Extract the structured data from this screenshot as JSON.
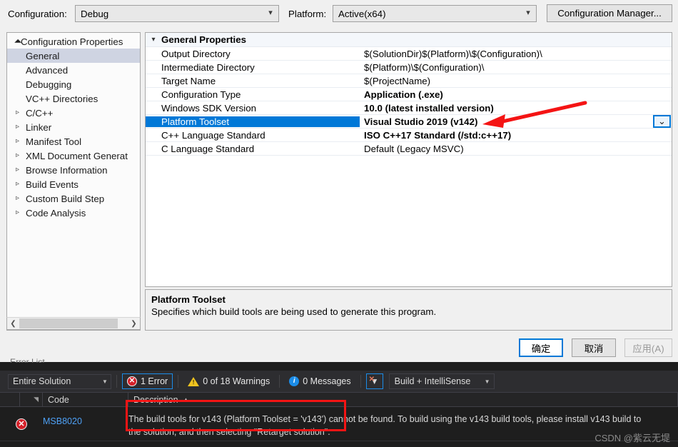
{
  "dialog": {
    "config_bar": {
      "configuration_label": "Configuration:",
      "configuration_value": "Debug",
      "platform_label": "Platform:",
      "platform_value": "Active(x64)",
      "configuration_manager_button": "Configuration Manager..."
    },
    "tree": {
      "items": [
        {
          "label": "Configuration Properties",
          "level": 0,
          "expander": "down",
          "selected": false
        },
        {
          "label": "General",
          "level": 1,
          "expander": "none",
          "selected": true
        },
        {
          "label": "Advanced",
          "level": 1,
          "expander": "none",
          "selected": false
        },
        {
          "label": "Debugging",
          "level": 1,
          "expander": "none",
          "selected": false
        },
        {
          "label": "VC++ Directories",
          "level": 1,
          "expander": "none",
          "selected": false
        },
        {
          "label": "C/C++",
          "level": 1,
          "expander": "right",
          "selected": false
        },
        {
          "label": "Linker",
          "level": 1,
          "expander": "right",
          "selected": false
        },
        {
          "label": "Manifest Tool",
          "level": 1,
          "expander": "right",
          "selected": false
        },
        {
          "label": "XML Document Generat",
          "level": 1,
          "expander": "right",
          "selected": false
        },
        {
          "label": "Browse Information",
          "level": 1,
          "expander": "right",
          "selected": false
        },
        {
          "label": "Build Events",
          "level": 1,
          "expander": "right",
          "selected": false
        },
        {
          "label": "Custom Build Step",
          "level": 1,
          "expander": "right",
          "selected": false
        },
        {
          "label": "Code Analysis",
          "level": 1,
          "expander": "right",
          "selected": false
        }
      ]
    },
    "grid": {
      "group_header": "General Properties",
      "rows": [
        {
          "name": "Output Directory",
          "value": "$(SolutionDir)$(Platform)\\$(Configuration)\\",
          "bold": false,
          "selected": false
        },
        {
          "name": "Intermediate Directory",
          "value": "$(Platform)\\$(Configuration)\\",
          "bold": false,
          "selected": false
        },
        {
          "name": "Target Name",
          "value": "$(ProjectName)",
          "bold": false,
          "selected": false
        },
        {
          "name": "Configuration Type",
          "value": "Application (.exe)",
          "bold": true,
          "selected": false
        },
        {
          "name": "Windows SDK Version",
          "value": "10.0 (latest installed version)",
          "bold": true,
          "selected": false
        },
        {
          "name": "Platform Toolset",
          "value": "Visual Studio 2019 (v142)",
          "bold": true,
          "selected": true
        },
        {
          "name": "C++ Language Standard",
          "value": "ISO C++17 Standard (/std:c++17)",
          "bold": true,
          "selected": false
        },
        {
          "name": "C Language Standard",
          "value": "Default (Legacy MSVC)",
          "bold": false,
          "selected": false
        }
      ],
      "dropdown_icon": "chevron-down-icon"
    },
    "description": {
      "title": "Platform Toolset",
      "body": "Specifies which build tools are being used to generate this program."
    },
    "buttons": {
      "ok": "确定",
      "cancel": "取消",
      "apply": "应用(A)"
    }
  },
  "error_list": {
    "caption": "Error List",
    "toolbar": {
      "scope": "Entire Solution",
      "errors": "1 Error",
      "warnings": "0 of 18 Warnings",
      "messages": "0 Messages",
      "filter_icon": "filter-clear-icon",
      "build_filter": "Build + IntelliSense"
    },
    "columns": [
      "",
      "",
      "Code",
      "Description"
    ],
    "sort_column": "Description",
    "rows": [
      {
        "severity": "error",
        "code": "MSB8020",
        "description": "The build tools for v143 (Platform Toolset = 'v143') cannot be found. To build using the v143 build tools, please install v143 build to",
        "description_line2": "the solution, and then selecting \"Retarget solution\"."
      }
    ]
  },
  "watermark": "CSDN @紫云无堤",
  "colors": {
    "selection_blue": "#0078d7",
    "annotation_red": "#f41414",
    "error_red": "#d32029",
    "warning_yellow": "#f0c420",
    "info_blue": "#1b8ce8",
    "link_blue": "#4ea1f5"
  }
}
